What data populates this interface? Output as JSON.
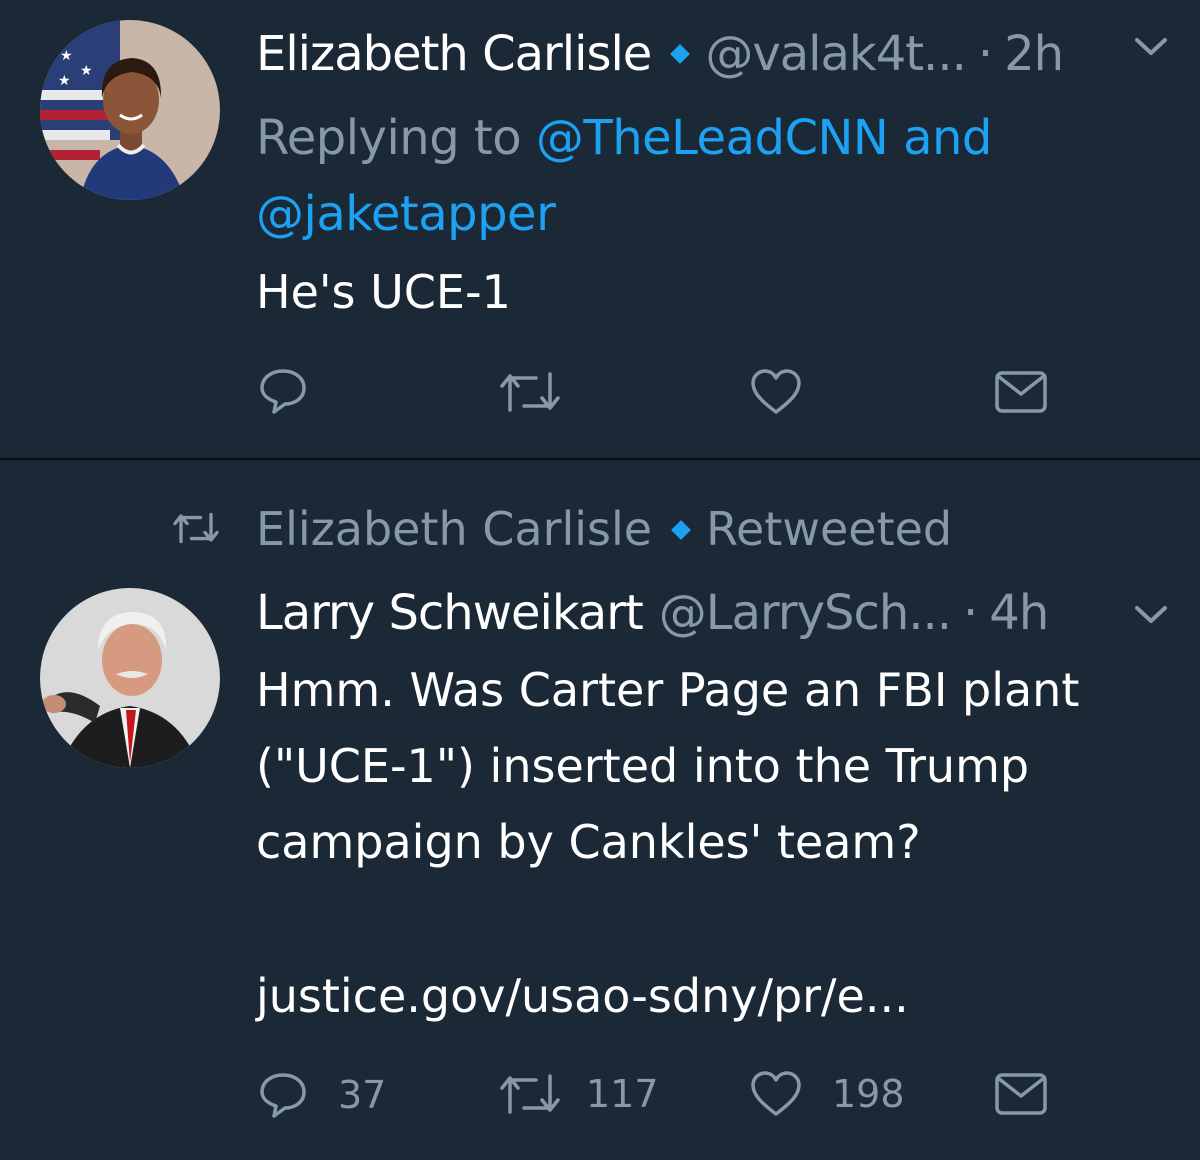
{
  "tweets": [
    {
      "author_name": "Elizabeth Carlisle",
      "handle": "@valak4t...",
      "separator": "·",
      "time": "2h",
      "replying_prefix": "Replying to",
      "replying_to_1": "@TheLeadCNN",
      "replying_and": "and",
      "replying_to_2": "@jaketapper",
      "text": "He's UCE-1",
      "reply_count": "",
      "retweet_count": "",
      "like_count": ""
    },
    {
      "retweeted_by": "Elizabeth Carlisle",
      "retweeted_label": "Retweeted",
      "author_name": "Larry Schweikart",
      "handle": "@LarrySch...",
      "separator": "·",
      "time": "4h",
      "text_line1": "Hmm. Was Carter Page an FBI plant",
      "text_line2": "(\"UCE-1\") inserted into the Trump",
      "text_line3": "campaign by Cankles' team?",
      "link_text": "justice.gov/usao-sdny/pr/e...",
      "reply_count": "37",
      "retweet_count": "117",
      "like_count": "198"
    }
  ],
  "icons": {
    "verified": "verified-badge-icon",
    "reply": "reply-icon",
    "retweet": "retweet-icon",
    "like": "heart-icon",
    "dm": "envelope-icon",
    "more": "chevron-down-icon"
  },
  "colors": {
    "background": "#1b2836",
    "accent": "#1da1f2",
    "muted": "#8899a6",
    "text": "#ffffff"
  }
}
